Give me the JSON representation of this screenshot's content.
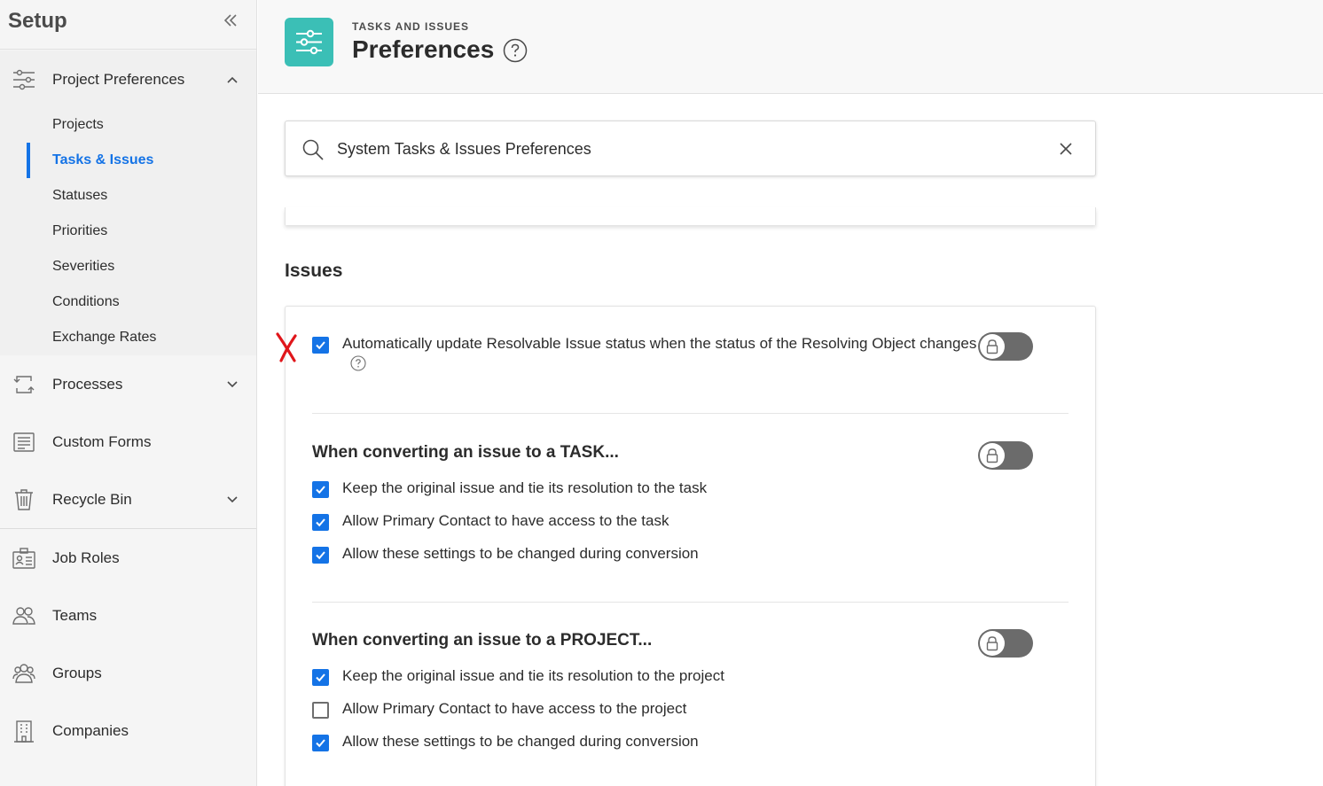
{
  "sidebar": {
    "title": "Setup",
    "group": {
      "label": "Project Preferences",
      "items": [
        {
          "label": "Projects"
        },
        {
          "label": "Tasks & Issues"
        },
        {
          "label": "Statuses"
        },
        {
          "label": "Priorities"
        },
        {
          "label": "Severities"
        },
        {
          "label": "Conditions"
        },
        {
          "label": "Exchange Rates"
        }
      ]
    },
    "nav": [
      {
        "label": "Processes"
      },
      {
        "label": "Custom Forms"
      },
      {
        "label": "Recycle Bin"
      },
      {
        "label": "Job Roles"
      },
      {
        "label": "Teams"
      },
      {
        "label": "Groups"
      },
      {
        "label": "Companies"
      }
    ]
  },
  "header": {
    "kicker": "TASKS AND ISSUES",
    "title": "Preferences"
  },
  "search": {
    "value": "System Tasks & Issues Preferences"
  },
  "issues": {
    "section_title": "Issues",
    "auto_update": {
      "label": "Automatically update Resolvable Issue status when the status of the Resolving Object changes",
      "checked": true
    },
    "task_group": {
      "title": "When converting an issue to a TASK...",
      "options": [
        {
          "label": "Keep the original issue and tie its resolution to the task",
          "checked": true
        },
        {
          "label": "Allow Primary Contact to have access to the task",
          "checked": true
        },
        {
          "label": "Allow these settings to be changed during conversion",
          "checked": true
        }
      ]
    },
    "project_group": {
      "title": "When converting an issue to a PROJECT...",
      "options": [
        {
          "label": "Keep the original issue and tie its resolution to the project",
          "checked": true
        },
        {
          "label": "Allow Primary Contact to have access to the project",
          "checked": false
        },
        {
          "label": "Allow these settings to be changed during conversion",
          "checked": true
        }
      ]
    }
  },
  "colors": {
    "accent": "#1473e6",
    "logo": "#3bbfb6",
    "toggle": "#6b6b6b",
    "annotation": "#e0161b"
  }
}
